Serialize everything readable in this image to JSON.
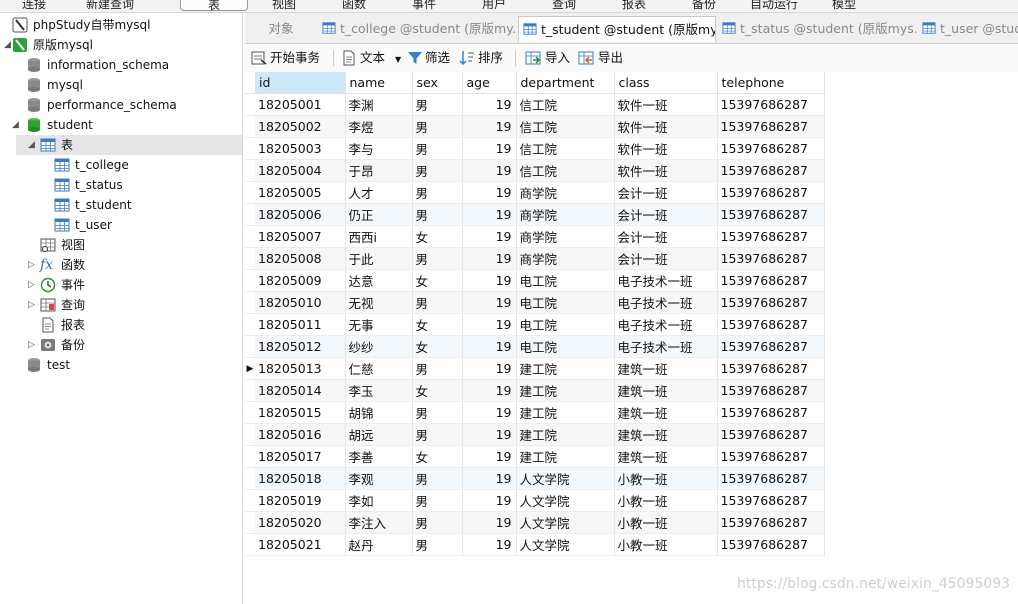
{
  "menubar": [
    "连接",
    "新建查询",
    "表",
    "视图",
    "函数",
    "事件",
    "用户",
    "查询",
    "报表",
    "备份",
    "自动运行",
    "模型"
  ],
  "sidebar": {
    "connections": [
      {
        "label": "phpStudy自带mysql"
      },
      {
        "label": "原版mysql"
      }
    ],
    "databases": [
      "information_schema",
      "mysql",
      "performance_schema",
      "student"
    ],
    "tables_group": "表",
    "tables": [
      "t_college",
      "t_status",
      "t_student",
      "t_user"
    ],
    "groups": [
      "视图",
      "函数",
      "事件",
      "查询",
      "报表",
      "备份"
    ],
    "last_db": "test"
  },
  "tabs": [
    {
      "label": "对象"
    },
    {
      "label": "t_college @student (原版my..."
    },
    {
      "label": "t_student @student (原版my..."
    },
    {
      "label": "t_status @student (原版mys..."
    },
    {
      "label": "t_user @stude"
    }
  ],
  "toolbar": {
    "begin_tx": "开始事务",
    "text": "文本",
    "filter": "筛选",
    "sort": "排序",
    "import": "导入",
    "export": "导出"
  },
  "table": {
    "columns": [
      "id",
      "name",
      "sex",
      "age",
      "department",
      "class",
      "telephone"
    ],
    "rows": [
      [
        "18205001",
        "李渊",
        "男",
        "19",
        "信工院",
        "软件一班",
        "15397686287"
      ],
      [
        "18205002",
        "李煜",
        "男",
        "19",
        "信工院",
        "软件一班",
        "15397686287"
      ],
      [
        "18205003",
        "李与",
        "男",
        "19",
        "信工院",
        "软件一班",
        "15397686287"
      ],
      [
        "18205004",
        "于昂",
        "男",
        "19",
        "信工院",
        "软件一班",
        "15397686287"
      ],
      [
        "18205005",
        "人才",
        "男",
        "19",
        "商学院",
        "会计一班",
        "15397686287"
      ],
      [
        "18205006",
        "仍正",
        "男",
        "19",
        "商学院",
        "会计一班",
        "15397686287"
      ],
      [
        "18205007",
        "西西i",
        "女",
        "19",
        "商学院",
        "会计一班",
        "15397686287"
      ],
      [
        "18205008",
        "于此",
        "男",
        "19",
        "商学院",
        "会计一班",
        "15397686287"
      ],
      [
        "18205009",
        "达意",
        "女",
        "19",
        "电工院",
        "电子技术一班",
        "15397686287"
      ],
      [
        "18205010",
        "无视",
        "男",
        "19",
        "电工院",
        "电子技术一班",
        "15397686287"
      ],
      [
        "18205011",
        "无事",
        "女",
        "19",
        "电工院",
        "电子技术一班",
        "15397686287"
      ],
      [
        "18205012",
        "纱纱",
        "女",
        "19",
        "电工院",
        "电子技术一班",
        "15397686287"
      ],
      [
        "18205013",
        "仁慈",
        "男",
        "19",
        "建工院",
        "建筑一班",
        "15397686287"
      ],
      [
        "18205014",
        "李玉",
        "女",
        "19",
        "建工院",
        "建筑一班",
        "15397686287"
      ],
      [
        "18205015",
        "胡锦",
        "男",
        "19",
        "建工院",
        "建筑一班",
        "15397686287"
      ],
      [
        "18205016",
        "胡远",
        "男",
        "19",
        "建工院",
        "建筑一班",
        "15397686287"
      ],
      [
        "18205017",
        "李善",
        "女",
        "19",
        "建工院",
        "建筑一班",
        "15397686287"
      ],
      [
        "18205018",
        "李观",
        "男",
        "19",
        "人文学院",
        "小教一班",
        "15397686287"
      ],
      [
        "18205019",
        "李如",
        "男",
        "19",
        "人文学院",
        "小教一班",
        "15397686287"
      ],
      [
        "18205020",
        "李注入",
        "男",
        "19",
        "人文学院",
        "小教一班",
        "15397686287"
      ],
      [
        "18205021",
        "赵丹",
        "男",
        "19",
        "人文学院",
        "小教一班",
        "15397686287"
      ]
    ]
  },
  "watermark": "https://blog.csdn.net/weixin_45095093"
}
